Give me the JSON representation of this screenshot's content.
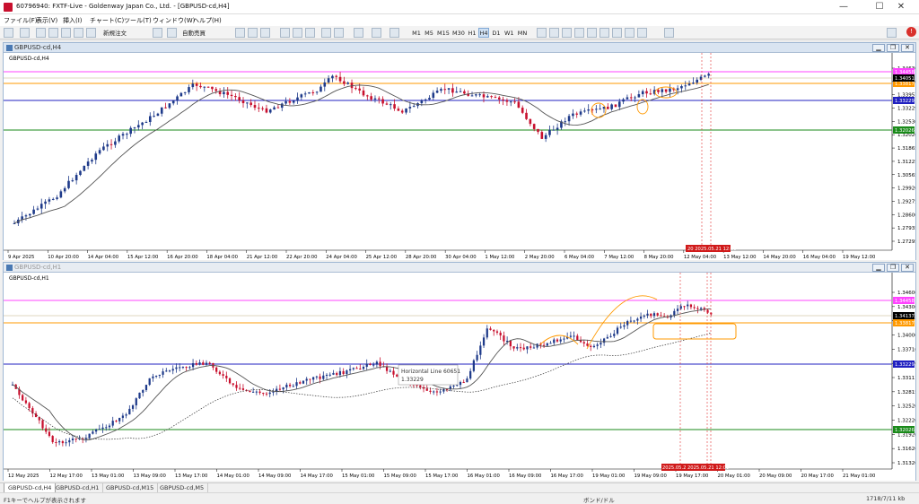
{
  "app": {
    "title": "60796940: FXTF-Live - Goldenway Japan Co., Ltd. - [GBPUSD-cd,H4]",
    "window_controls": [
      "—",
      "☐",
      "✕"
    ]
  },
  "menu": [
    "ファイル(F)",
    "表示(V)",
    "挿入(I)",
    "チャート(C)",
    "ツール(T)",
    "ウィンドウ(W)",
    "ヘルプ(H)"
  ],
  "toolbar": {
    "new_order": "新規注文",
    "auto_trade": "自動売買",
    "timeframes": [
      "M1",
      "M5",
      "M15",
      "M30",
      "H1",
      "H4",
      "D1",
      "W1",
      "MN"
    ],
    "help_icon": "!"
  },
  "chart_top": {
    "window_title": "GBPUSD-cd,H4",
    "label": "GBPUSD-cd,H4",
    "price_labels": [
      "1.34630",
      "1.34200",
      "1.33957",
      "1.33229",
      "1.32530",
      "1.32026",
      "1.31865",
      "1.31225",
      "1.30565",
      "1.29920",
      "1.29275",
      "1.28600",
      "1.27935",
      "1.27295"
    ],
    "hlines": {
      "magenta": "1.34458",
      "orange": "1.33817",
      "blue": "1.33229",
      "green": "1.32026",
      "current": "1.34051"
    },
    "time_labels": [
      "9 Apr 2025",
      "10 Apr 20:00",
      "14 Apr 04:00",
      "15 Apr 12:00",
      "16 Apr 20:00",
      "18 Apr 04:00",
      "21 Apr 12:00",
      "22 Apr 20:00",
      "24 Apr 04:00",
      "25 Apr 12:00",
      "28 Apr 20:00",
      "30 Apr 04:00",
      "1 May 12:00",
      "2 May 20:00",
      "6 May 04:00",
      "7 May 12:00",
      "8 May 20:00",
      "12 May 04:00",
      "13 May 12:00",
      "14 May 20:00",
      "16 May 04:00",
      "19 May 12:00"
    ],
    "time_marker": "20 2025.05.21 12:00"
  },
  "chart_bottom": {
    "window_title": "GBPUSD-cd,H1",
    "label": "GBPUSD-cd,H1",
    "price_labels": [
      "1.34600",
      "1.34300",
      "1.34137",
      "1.34000",
      "1.33710",
      "1.33410",
      "1.33111",
      "1.32815",
      "1.32520",
      "1.32220",
      "1.31920",
      "1.31620",
      "1.31320"
    ],
    "hlines": {
      "magenta": "1.34458",
      "orange": "1.33817",
      "blue": "1.33229",
      "green": "1.32026",
      "current": "1.34137"
    },
    "tooltip": {
      "title": "Horizontal Line 60651",
      "value": "1.33229"
    },
    "time_labels": [
      "12 May 2025",
      "12 May 17:00",
      "13 May 01:00",
      "13 May 09:00",
      "13 May 17:00",
      "14 May 01:00",
      "14 May 09:00",
      "14 May 17:00",
      "15 May 01:00",
      "15 May 09:00",
      "15 May 17:00",
      "16 May 01:00",
      "16 May 09:00",
      "16 May 17:00",
      "19 May 01:00",
      "19 May 09:00",
      "19 May 17:00",
      "20 May 01:00",
      "20 May 09:00",
      "20 May 17:00",
      "21 May 01:00"
    ],
    "time_markers": [
      "2025.05.21 10",
      "2025.05.21 12:00"
    ]
  },
  "tabs": [
    "GBPUSD-cd,H4",
    "GBPUSD-cd,H1",
    "GBPUSD-cd,M15",
    "GBPUSD-cd,M5"
  ],
  "status": {
    "help": "F1キーでヘルプが表示されます",
    "profile": "ボンド/ドル",
    "traffic": "1718/7/11 kb"
  },
  "colors": {
    "bull": "#1e3a8a",
    "bear": "#c8102e",
    "magenta": "#ff44ff",
    "orange": "#ff9900",
    "blue": "#2020c0",
    "green": "#1a8a1a",
    "ma": "#555555"
  }
}
